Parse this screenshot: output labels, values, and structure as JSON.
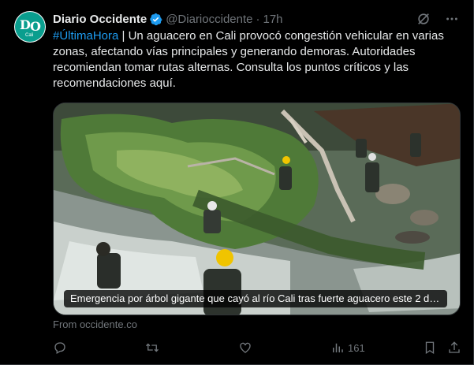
{
  "author": {
    "name": "Diario Occidente",
    "handle": "@Diarioccidente",
    "separator": "·",
    "time": "17h",
    "avatar_letters": [
      "D",
      "O"
    ],
    "avatar_sub": "Cali"
  },
  "tweet": {
    "hashtag": "#ÚltimaHora",
    "body": " | Un aguacero en Cali provocó congestión vehicular en varias zonas, afectando vías principales y generando demoras. Autoridades recomiendan tomar rutas alternas. Consulta los puntos críticos y las recomendaciones aquí."
  },
  "media": {
    "caption": "Emergencia por árbol gigante que cayó al río Cali tras fuerte aguacero este 2 de…"
  },
  "source": "From occidente.co",
  "actions": {
    "replies": "",
    "retweets": "",
    "likes": "",
    "views": "161"
  },
  "icons": [
    "verified-badge-icon",
    "grok-icon",
    "more-icon",
    "reply-icon",
    "retweet-icon",
    "like-icon",
    "views-icon",
    "bookmark-icon",
    "share-icon"
  ],
  "colors": {
    "background": "#000000",
    "text": "#e7e9ea",
    "secondary": "#71767b",
    "accent": "#1d9bf0",
    "avatar": "#0a9e8e"
  }
}
